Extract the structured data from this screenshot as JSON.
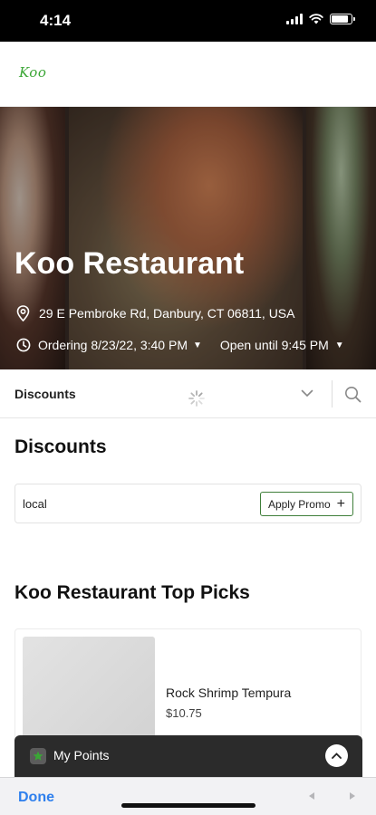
{
  "status_bar": {
    "time": "4:14",
    "battery_level": 0.85
  },
  "header": {
    "logo_text": "Koo",
    "accent_color": "#3aa635"
  },
  "hero": {
    "title": "Koo Restaurant",
    "address": "29 E Pembroke Rd, Danbury, CT 06811, USA",
    "ordering": "Ordering 8/23/22, 3:40 PM",
    "hours": "Open until 9:45 PM",
    "icons": [
      "location-pin-icon",
      "clock-icon",
      "chevron-down-icon"
    ]
  },
  "category_bar": {
    "current": "Discounts",
    "icons": [
      "loading-spinner-icon",
      "chevron-down-icon",
      "search-icon"
    ]
  },
  "discounts": {
    "title": "Discounts",
    "promo_code": "local",
    "apply_label": "Apply Promo",
    "apply_icon": "plus-icon",
    "button_border_color": "#3f7f3a"
  },
  "top_picks": {
    "title": "Koo Restaurant Top Picks",
    "items": [
      {
        "name": "Rock Shrimp Tempura",
        "price": "$10.75"
      }
    ]
  },
  "points_bar": {
    "label": "My Points",
    "icons": [
      "star-icon",
      "chevron-up-icon"
    ],
    "star_color": "#3aa635"
  },
  "toolbar": {
    "done_label": "Done",
    "link_color": "#2f80ed",
    "icons": [
      "back-arrow-icon",
      "forward-arrow-icon"
    ]
  }
}
